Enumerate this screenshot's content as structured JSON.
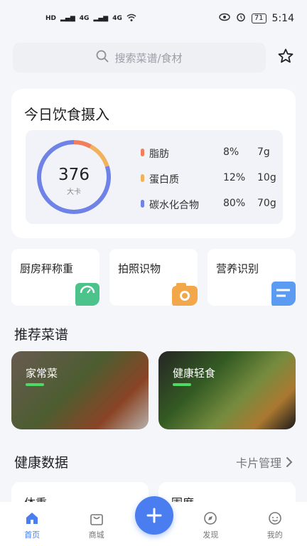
{
  "status_bar": {
    "left_indicators": [
      "HD",
      "4G",
      "4G"
    ],
    "battery": "71",
    "time": "5:14"
  },
  "search": {
    "placeholder": "搜索菜谱/食材"
  },
  "intake": {
    "title": "今日饮食摄入",
    "calories_value": "376",
    "calories_unit": "大卡",
    "nutrients": [
      {
        "name": "脂肪",
        "percent": "8%",
        "amount": "7g",
        "color": "#f27f5b",
        "fraction": 0.08
      },
      {
        "name": "蛋白质",
        "percent": "12%",
        "amount": "10g",
        "color": "#f2b25b",
        "fraction": 0.12
      },
      {
        "name": "碳水化合物",
        "percent": "80%",
        "amount": "70g",
        "color": "#6f83e6",
        "fraction": 0.8
      }
    ]
  },
  "tools": [
    {
      "label": "厨房秤称重",
      "icon": "scale-icon",
      "color": "#4cc38a"
    },
    {
      "label": "拍照识物",
      "icon": "camera-icon",
      "color": "#f2a84a"
    },
    {
      "label": "营养识别",
      "icon": "document-icon",
      "color": "#5b9cf2"
    }
  ],
  "recommended": {
    "title": "推荐菜谱",
    "cards": [
      {
        "label": "家常菜"
      },
      {
        "label": "健康轻食"
      }
    ]
  },
  "health": {
    "title": "健康数据",
    "manage_label": "卡片管理",
    "cards": [
      {
        "label": "体重"
      },
      {
        "label": "围度"
      }
    ]
  },
  "tabbar": {
    "tabs": [
      {
        "label": "首页",
        "icon": "home-icon",
        "active": true
      },
      {
        "label": "商城",
        "icon": "shopping-bag-icon",
        "active": false
      },
      {
        "label": "发现",
        "icon": "discover-icon",
        "active": false
      },
      {
        "label": "我的",
        "icon": "profile-icon",
        "active": false
      }
    ]
  },
  "colors": {
    "accent": "#4a7ef0",
    "background": "#f4f6f9"
  }
}
